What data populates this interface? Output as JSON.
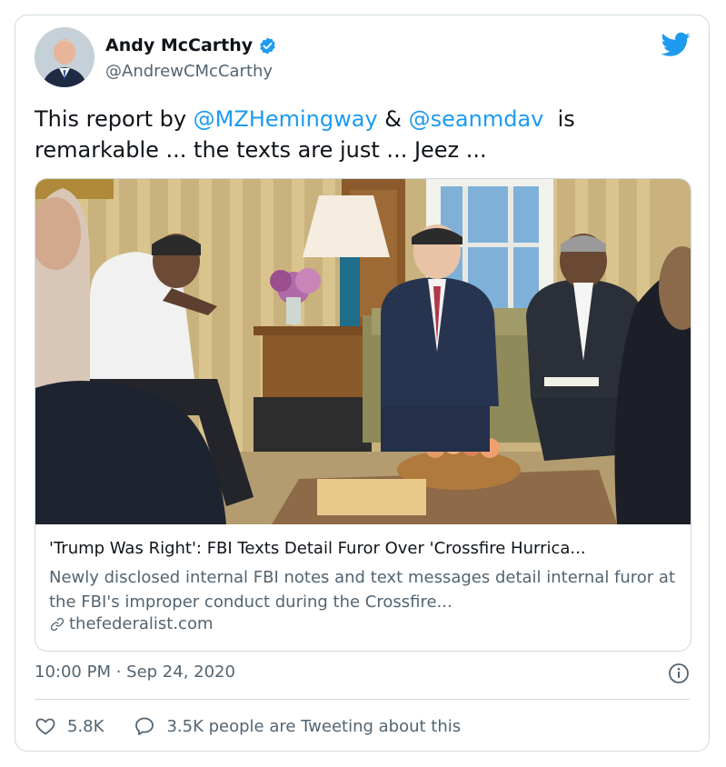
{
  "author": {
    "name": "Andy McCarthy",
    "handle": "@AndrewCMcCarthy",
    "verified_icon": "verified-badge-icon"
  },
  "tweet": {
    "text_parts": [
      {
        "text": "This report by ",
        "type": "plain"
      },
      {
        "text": "@MZHemingway",
        "type": "mention"
      },
      {
        "text": " & ",
        "type": "plain"
      },
      {
        "text": "@seanmdav",
        "type": "mention"
      },
      {
        "text": "  is remarkable ... the texts are just ... Jeez ...",
        "type": "plain"
      }
    ]
  },
  "link_card": {
    "title": "'Trump Was Right': FBI Texts Detail Furor Over 'Crossfire Hurrica...",
    "description": "Newly disclosed internal FBI notes and text messages detail internal furor at the FBI's improper conduct during the Crossfire...",
    "domain": "thefederalist.com"
  },
  "timestamp": "10:00 PM · Sep 24, 2020",
  "actions": {
    "likes": "5.8K",
    "conversation": "3.5K people are Tweeting about this"
  },
  "colors": {
    "brand": "#1d9bf0",
    "text": "#0f1419",
    "secondary": "#536471",
    "border": "#cfd9de"
  }
}
